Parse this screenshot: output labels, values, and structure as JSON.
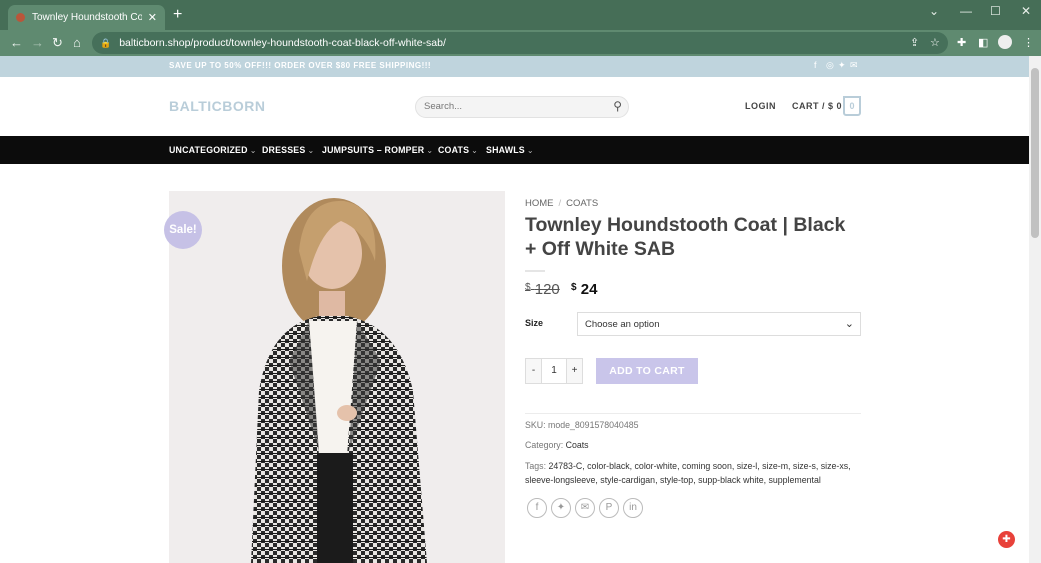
{
  "browser": {
    "tab_title": "Townley Houndstooth Coat | Bla",
    "url": "balticborn.shop/product/townley-houndstooth-coat-black-off-white-sab/"
  },
  "promo": {
    "text": "SAVE UP TO 50% OFF!!! ORDER OVER $80 FREE SHIPPING!!!"
  },
  "header": {
    "logo": "BALTICBORN",
    "search_placeholder": "Search...",
    "login": "LOGIN",
    "cart_label": "CART / $ 0",
    "cart_count": "0"
  },
  "nav": {
    "items": [
      "UNCATEGORIZED",
      "DRESSES",
      "JUMPSUITS – ROMPER",
      "COATS",
      "SHAWLS"
    ]
  },
  "product": {
    "sale_badge": "Sale!",
    "breadcrumb": [
      "HOME",
      "COATS"
    ],
    "title": "Townley Houndstooth Coat | Black + Off White SAB",
    "price_old_currency": "$",
    "price_old": "120",
    "price_new_currency": "$",
    "price_new": "24",
    "size_label": "Size",
    "size_option": "Choose an option",
    "qty_minus": "-",
    "qty_value": "1",
    "qty_plus": "+",
    "add_to_cart": "ADD TO CART",
    "sku_label": "SKU:",
    "sku": "mode_8091578040485",
    "category_label": "Category:",
    "category": "Coats",
    "tags_label": "Tags:",
    "tags": "24783-C, color-black, color-white, coming soon, size-l, size-m, size-s, size-xs, sleeve-longsleeve, style-cardigan, style-top, supp-black white, supplemental"
  },
  "colors": {
    "promo_bg": "#bfd4dd",
    "accent": "#c9c5ea",
    "nav_bg": "#0c0c0c",
    "chrome": "#466e57"
  }
}
